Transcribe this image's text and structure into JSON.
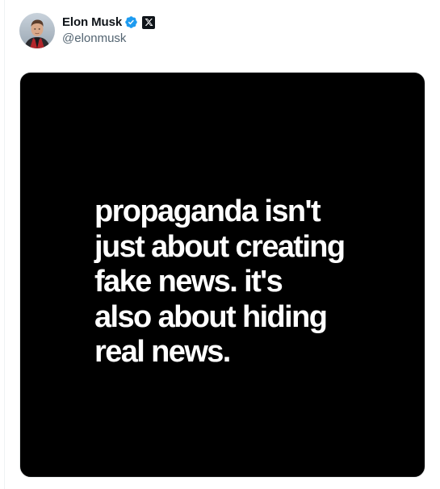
{
  "author": {
    "display_name": "Elon Musk",
    "handle": "@elonmusk",
    "verified_icon": "verified-badge-icon",
    "affiliate_icon": "x-logo-icon",
    "verified_color": "#1d9bf0"
  },
  "media": {
    "background": "#000000",
    "text_color": "#ffffff",
    "lines": [
      "propaganda isn't",
      "just about creating",
      "fake news. it's",
      "also about hiding",
      "real news."
    ]
  }
}
